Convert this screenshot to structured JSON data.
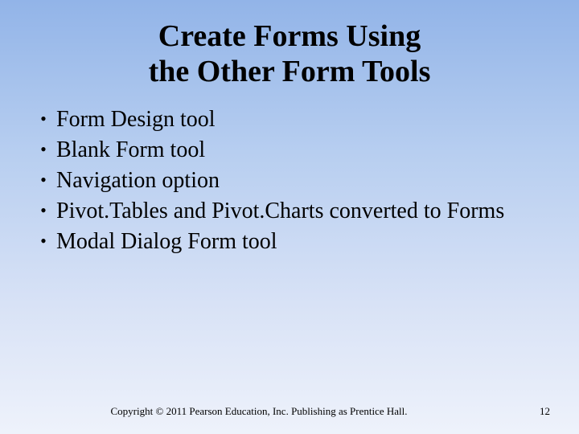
{
  "title_line1": "Create Forms Using",
  "title_line2": "the Other Form Tools",
  "bullets": [
    "Form Design tool",
    "Blank Form tool",
    "Navigation option",
    "Pivot.Tables and Pivot.Charts converted to Forms",
    "Modal Dialog Form tool"
  ],
  "copyright": "Copyright © 2011 Pearson Education, Inc. Publishing as Prentice Hall.",
  "page_number": "12"
}
